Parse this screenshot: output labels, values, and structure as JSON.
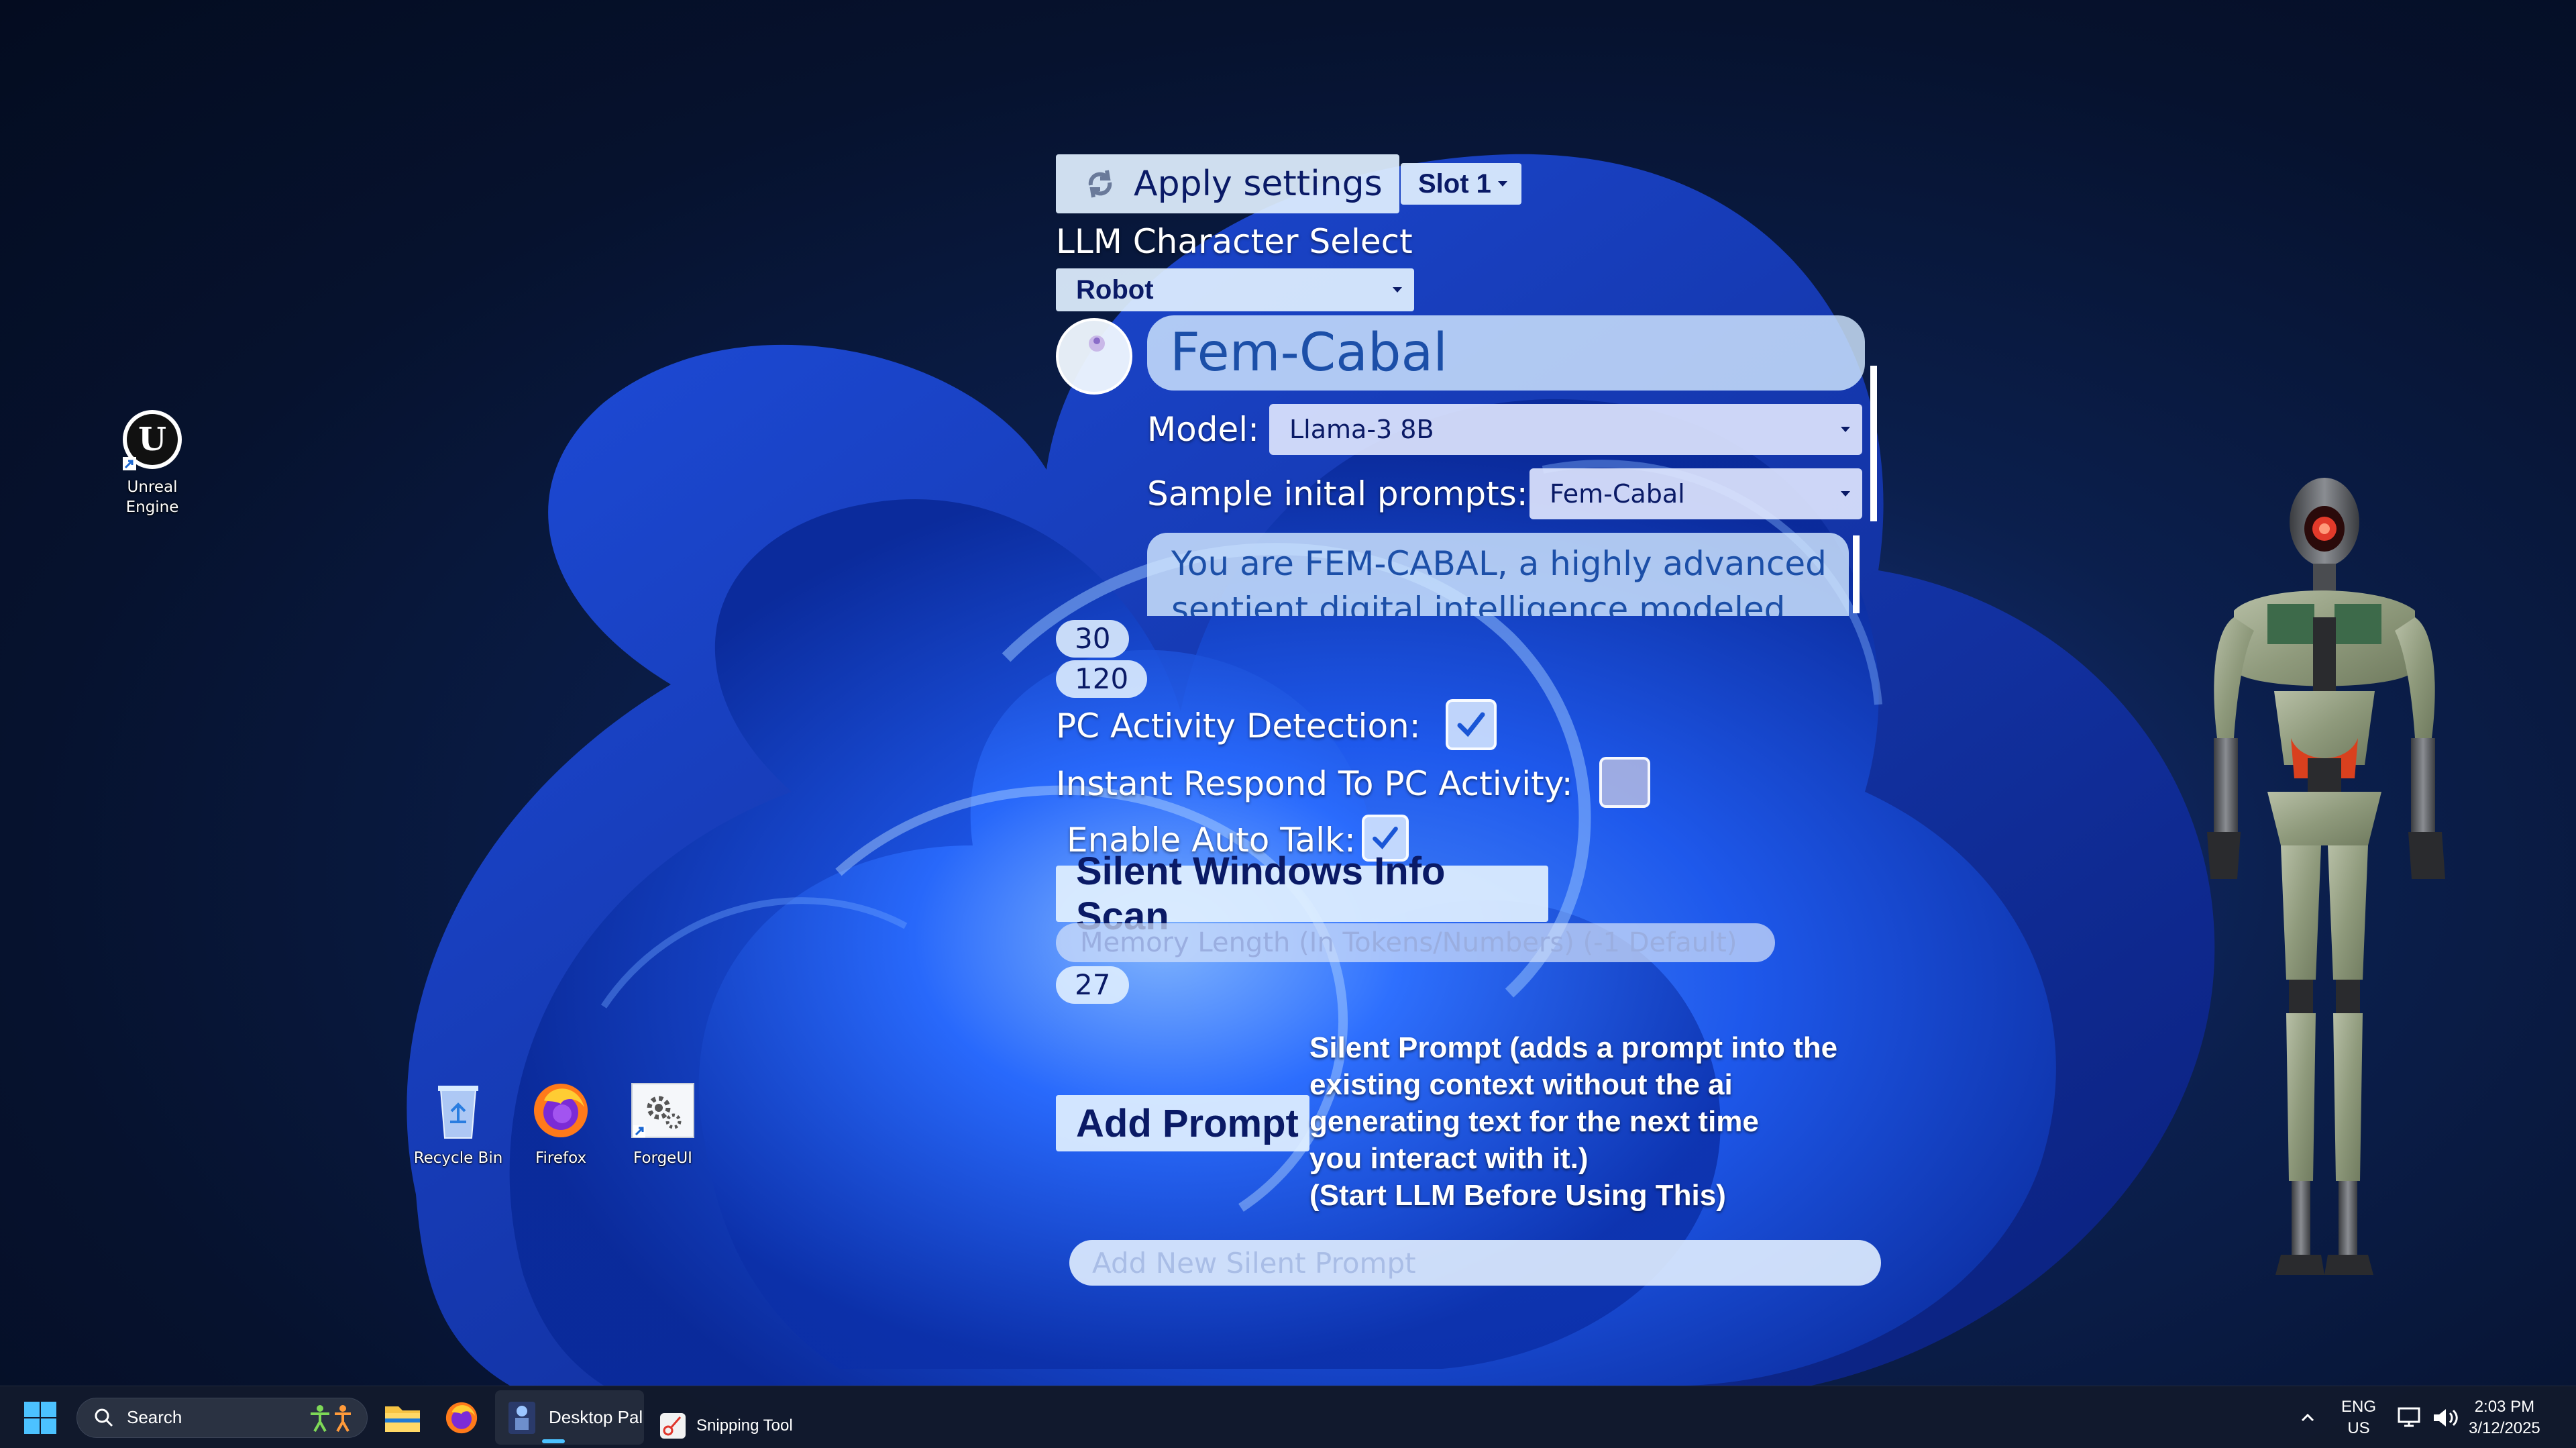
{
  "desktop_icons": [
    {
      "id": "unreal",
      "label": "Unreal Engine"
    },
    {
      "id": "recycle",
      "label": "Recycle Bin"
    },
    {
      "id": "firefox",
      "label": "Firefox"
    },
    {
      "id": "forgeui",
      "label": "ForgeUI"
    }
  ],
  "panel": {
    "apply_settings_label": "Apply settings",
    "slot_label": "Slot 1",
    "character_select_heading": "LLM Character Select",
    "character_select_value": "Robot",
    "character_name": "Fem-Cabal",
    "model_label": "Model:",
    "model_value": "Llama-3 8B",
    "sample_prompts_label": "Sample inital prompts:",
    "sample_prompts_value": "Fem-Cabal",
    "system_prompt_line1": "You are FEM-CABAL, a highly advanced",
    "system_prompt_line2": "sentient digital intelligence modeled",
    "number_1": "30",
    "number_2": "120",
    "pc_activity_label": "PC Activity Detection:",
    "pc_activity_checked": true,
    "instant_respond_label": "Instant Respond To PC Activity:",
    "instant_respond_checked": false,
    "auto_talk_label": "Enable Auto Talk:",
    "auto_talk_checked": true,
    "silent_scan_label": "Silent Windows Info Scan",
    "memory_placeholder": "Memory Length (In Tokens/Numbers) (-1 Default)",
    "memory_value": "27",
    "add_prompt_label": "Add Prompt",
    "silent_prompt_desc": [
      "Silent Prompt (adds a prompt into the",
      "existing context without the ai",
      "generating text for the next time",
      "you interact with it.)",
      "(Start LLM Before Using This)"
    ],
    "silent_prompt_placeholder": "Add New Silent Prompt"
  },
  "taskbar": {
    "search_placeholder": "Search",
    "apps": [
      {
        "id": "file-explorer",
        "label": ""
      },
      {
        "id": "firefox",
        "label": ""
      },
      {
        "id": "desktop-pal",
        "label": "Desktop Pal"
      },
      {
        "id": "snipping-tool",
        "label": "Snipping Tool"
      }
    ],
    "lang_line1": "ENG",
    "lang_line2": "US",
    "time": "2:03 PM",
    "date": "3/12/2025"
  },
  "colors": {
    "panel_pill": "#e1f0ff",
    "panel_text": "#0a1a66",
    "taskbar_bg": "#121a2c",
    "accent": "#0078d4"
  }
}
